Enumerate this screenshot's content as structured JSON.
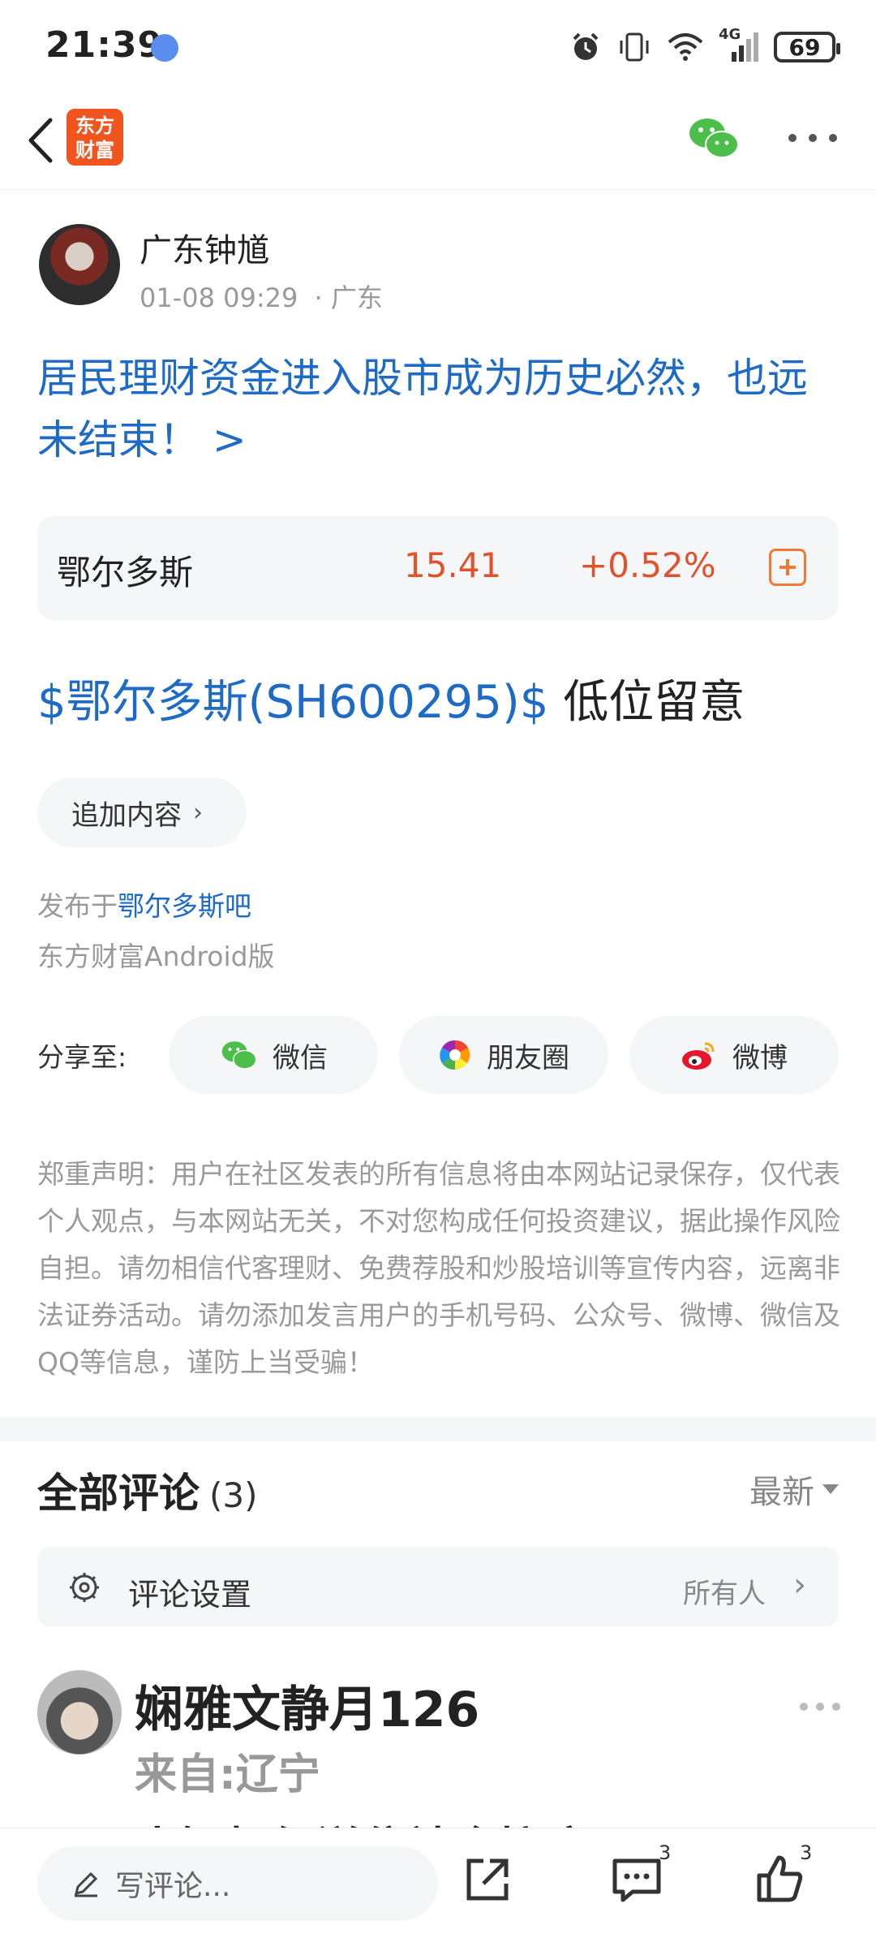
{
  "status_bar": {
    "time": "21:39",
    "network": "4G",
    "battery": "69",
    "icons": [
      "alarm-icon",
      "vibrate-icon",
      "wifi-icon",
      "signal-icon",
      "battery-icon"
    ]
  },
  "nav": {
    "back_icon": "back-arrow-icon",
    "logo_text": "东方\n财富",
    "wechat_icon": "wechat-icon",
    "more_icon": "more-icon"
  },
  "author": {
    "name": "广东钟馗",
    "datetime": "01-08 09:29",
    "location": "· 广东"
  },
  "post": {
    "title": "居民理财资金进入股市成为历史必然，也远未结束！ >",
    "body_link": "$鄂尔多斯(SH600295)$",
    "body_text": " 低位留意"
  },
  "stock": {
    "name": "鄂尔多斯",
    "price": "15.41",
    "change": "+0.52%",
    "add_icon": "add-square-icon"
  },
  "append": {
    "label": "追加内容",
    "chevron": "›"
  },
  "meta": {
    "published_prefix": "发布于",
    "published_forum": "鄂尔多斯吧",
    "client": "东方财富Android版"
  },
  "share": {
    "label": "分享至:",
    "wechat": "微信",
    "moments": "朋友圈",
    "weibo": "微博"
  },
  "disclaimer": "郑重声明：用户在社区发表的所有信息将由本网站记录保存，仅代表个人观点，与本网站无关，不对您构成任何投资建议，据此操作风险自担。请勿相信代客理财、免费荐股和炒股培训等宣传内容，远离非法证券活动。请勿添加发言用户的手机号码、公众号、微博、微信及QQ等信息，谨防上当受骗！",
  "comments": {
    "title": "全部评论",
    "count": "(3)",
    "sort": "最新",
    "settings_label": "评论设置",
    "settings_value": "所有人",
    "settings_chevron": "›",
    "items": [
      {
        "name": "娴雅文静月126",
        "location": "来自:辽宁",
        "text_peek": "士短根红送住神食接这"
      }
    ]
  },
  "bottom_bar": {
    "write_placeholder": "写评论...",
    "comment_count": "3",
    "like_count": "3"
  },
  "colors": {
    "link_blue": "#1e6bc7",
    "up_red": "#e0512c",
    "brand_orange": "#f0551f",
    "wechat_green": "#4cbf4a"
  }
}
